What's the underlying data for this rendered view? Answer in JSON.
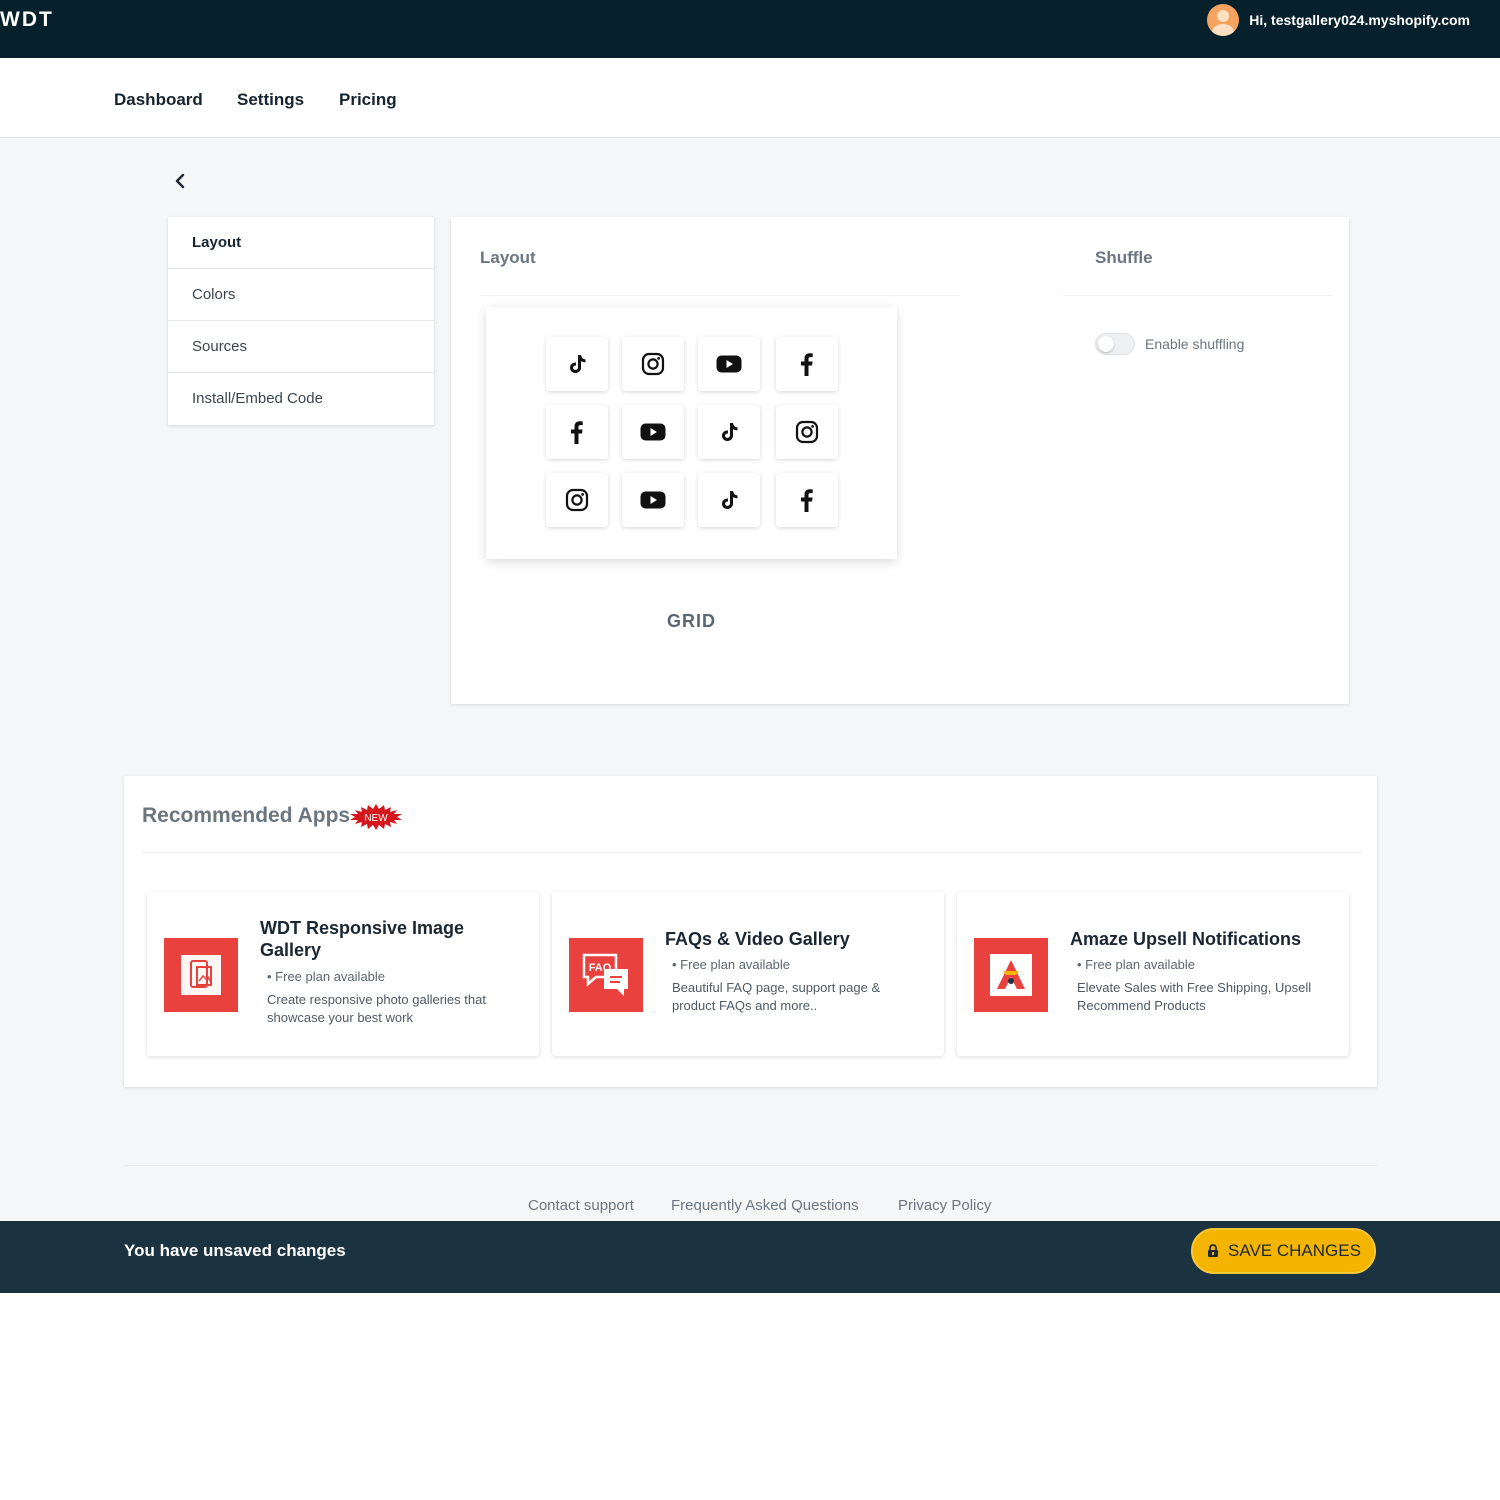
{
  "header": {
    "brand": "WDT",
    "greeting": "Hi, testgallery024.myshopify.com"
  },
  "nav": {
    "items": [
      "Dashboard",
      "Settings",
      "Pricing"
    ]
  },
  "sidebar": {
    "items": [
      {
        "label": "Layout",
        "active": true
      },
      {
        "label": "Colors",
        "active": false
      },
      {
        "label": "Sources",
        "active": false
      },
      {
        "label": "Install/Embed Code",
        "active": false
      }
    ]
  },
  "layout_panel": {
    "title": "Layout",
    "grid_preview": {
      "rows": [
        [
          "tiktok-icon",
          "instagram-icon",
          "youtube-icon",
          "facebook-icon"
        ],
        [
          "facebook-icon",
          "youtube-icon",
          "tiktok-icon",
          "instagram-icon"
        ],
        [
          "instagram-icon",
          "youtube-icon",
          "tiktok-icon",
          "facebook-icon"
        ]
      ]
    },
    "grid_label": "GRID"
  },
  "shuffle_panel": {
    "title": "Shuffle",
    "toggle_label": "Enable shuffling",
    "enabled": false
  },
  "recommended": {
    "title": "Recommended Apps",
    "badge": "NEW",
    "apps": [
      {
        "name": "WDT Responsive Image Gallery",
        "plan": "Free plan available",
        "description": "Create responsive photo galleries that showcase your best work",
        "icon": "gallery-icon"
      },
      {
        "name": "FAQs & Video Gallery",
        "plan": "Free plan available",
        "description": "Beautiful FAQ page, support page & product FAQs and more..",
        "icon": "faq-icon"
      },
      {
        "name": "Amaze Upsell Notifications",
        "plan": "Free plan available",
        "description": "Elevate Sales with Free Shipping, Upsell Recommend Products",
        "icon": "upsell-icon"
      }
    ]
  },
  "footer": {
    "links": [
      "Contact support",
      "Frequently Asked Questions",
      "Privacy Policy"
    ]
  },
  "unsaved_bar": {
    "message": "You have unsaved changes",
    "save_label": "SAVE CHANGES"
  },
  "colors": {
    "topbar": "#06202c",
    "unsaved_bar": "#1b3340",
    "save_button": "#f4b400",
    "app_icon_bg": "#e8413e"
  }
}
